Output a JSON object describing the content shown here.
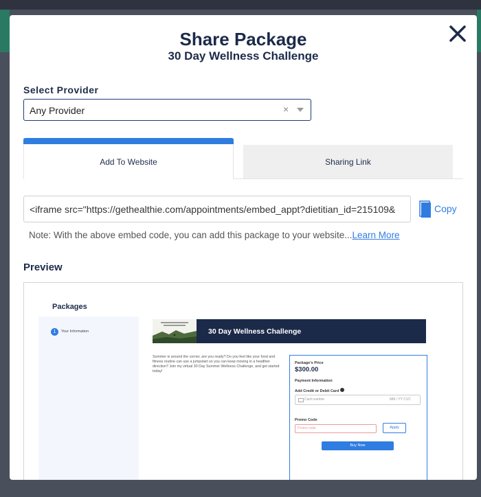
{
  "modal": {
    "title": "Share Package",
    "subtitle": "30 Day Wellness Challenge",
    "close_icon": "close-icon"
  },
  "provider": {
    "label": "Select Provider",
    "selected": "Any Provider",
    "clear_symbol": "×"
  },
  "tabs": [
    {
      "label": "Add To Website",
      "active": true
    },
    {
      "label": "Sharing Link",
      "active": false
    }
  ],
  "embed": {
    "code": "<iframe src=\"https://gethealthie.com/appointments/embed_appt?dietitian_id=215109&",
    "copy_label": "Copy",
    "note": "Note: With the above embed code, you can add this package to your website...",
    "learn_more": "Learn More"
  },
  "preview": {
    "label": "Preview",
    "packages_heading": "Packages",
    "step_number": "1",
    "step_label": "Your Information",
    "banner_title": "30 Day Wellness Challenge",
    "description": "Summer is around the corner, are you ready? Do you feel like your food and fitness routine can use a jumpstart so you can keep moving in a healthier direction? Join my virtual 30 Day Summer Wellness Challenge, and get started today!",
    "price_label": "Package's Price",
    "price": "$300.00",
    "payment_info": "Payment Information",
    "add_card": "Add Credit or Debit Card",
    "card_placeholder": "Card number",
    "card_expiry_placeholder": "MM / YY  CVC",
    "promo_label": "Promo Code",
    "promo_placeholder": "Promo code",
    "apply_label": "Apply",
    "buy_label": "Buy Now"
  },
  "colors": {
    "accent": "#2f7de1",
    "navy": "#1c2a4a"
  }
}
